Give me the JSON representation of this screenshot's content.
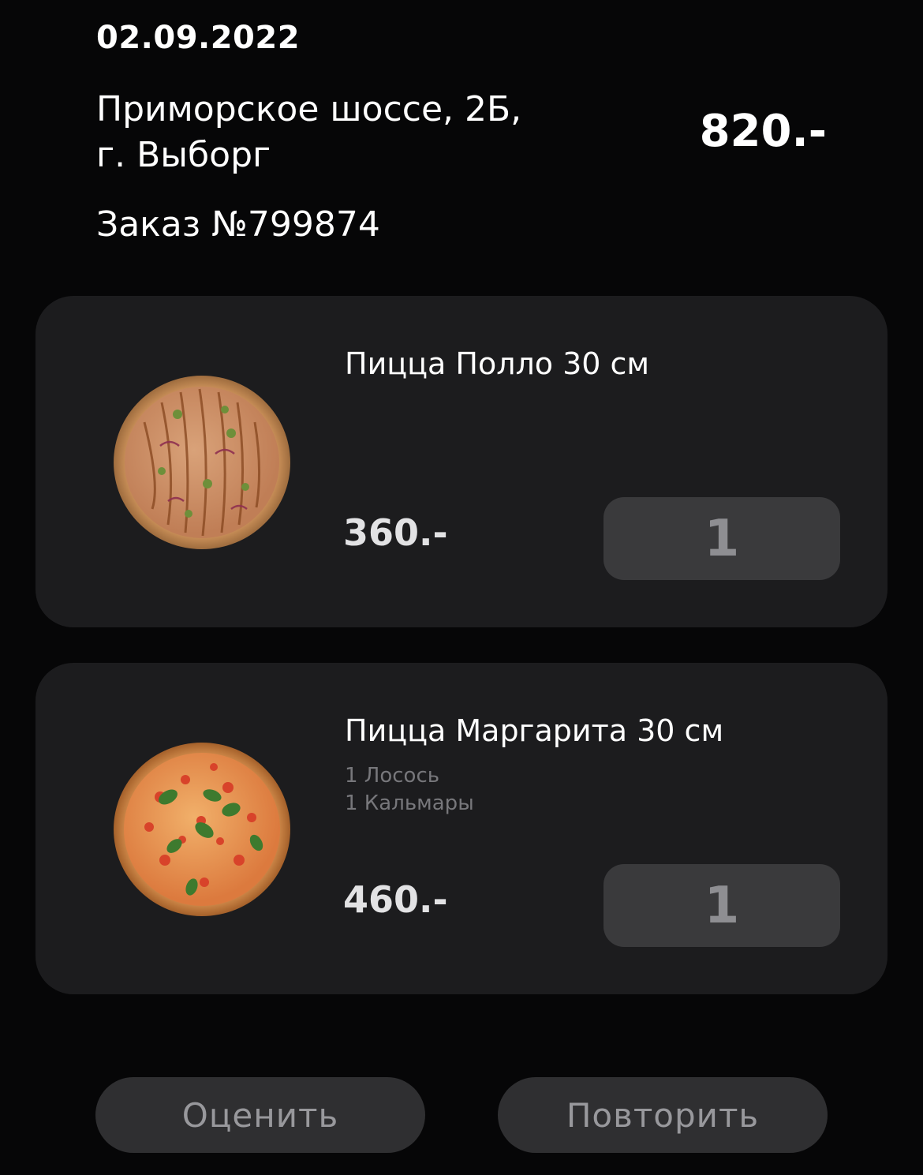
{
  "order": {
    "date": "02.09.2022",
    "address_line1": "Приморское шоссе, 2Б,",
    "address_line2": "г. Выборг",
    "total": "820.-",
    "number_label": "Заказ №799874"
  },
  "items": [
    {
      "name": "Пицца Полло 30 см",
      "modifiers": [],
      "price": "360.-",
      "quantity": "1",
      "image": "pizza-pollo-icon"
    },
    {
      "name": "Пицца Маргарита 30 см",
      "modifiers": [
        "1 Лосось",
        "1 Кальмары"
      ],
      "price": "460.-",
      "quantity": "1",
      "image": "pizza-margherita-icon"
    }
  ],
  "actions": {
    "rate_label": "Оценить",
    "repeat_label": "Повторить"
  }
}
